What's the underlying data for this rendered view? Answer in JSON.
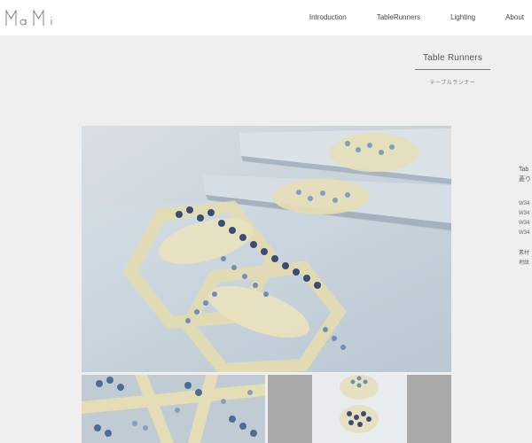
{
  "brand": {
    "logo_text": "MaMi"
  },
  "nav": {
    "items": [
      {
        "label": "Introduction"
      },
      {
        "label": "TableRunners"
      },
      {
        "label": "Lighting"
      },
      {
        "label": "About"
      }
    ]
  },
  "section": {
    "title": "Table Runners",
    "subtitle": "テーブルランナー"
  },
  "side_info": {
    "line1": "Tab",
    "line2": "菱り",
    "sizes": [
      "W34",
      "W34",
      "W34",
      "W34"
    ],
    "material1": "素材",
    "material2": "地紋"
  },
  "images": {
    "main": "table-runner-photo",
    "thumb1": "runner-closeup-photo",
    "thumb2": "runner-flat-photo"
  },
  "colors": {
    "page_bg": "#efefef",
    "header_bg": "#ffffff",
    "fabric_blue": "#c3ced6",
    "pattern_gold": "#e6dfb8",
    "pattern_navy": "#3a4c72"
  }
}
